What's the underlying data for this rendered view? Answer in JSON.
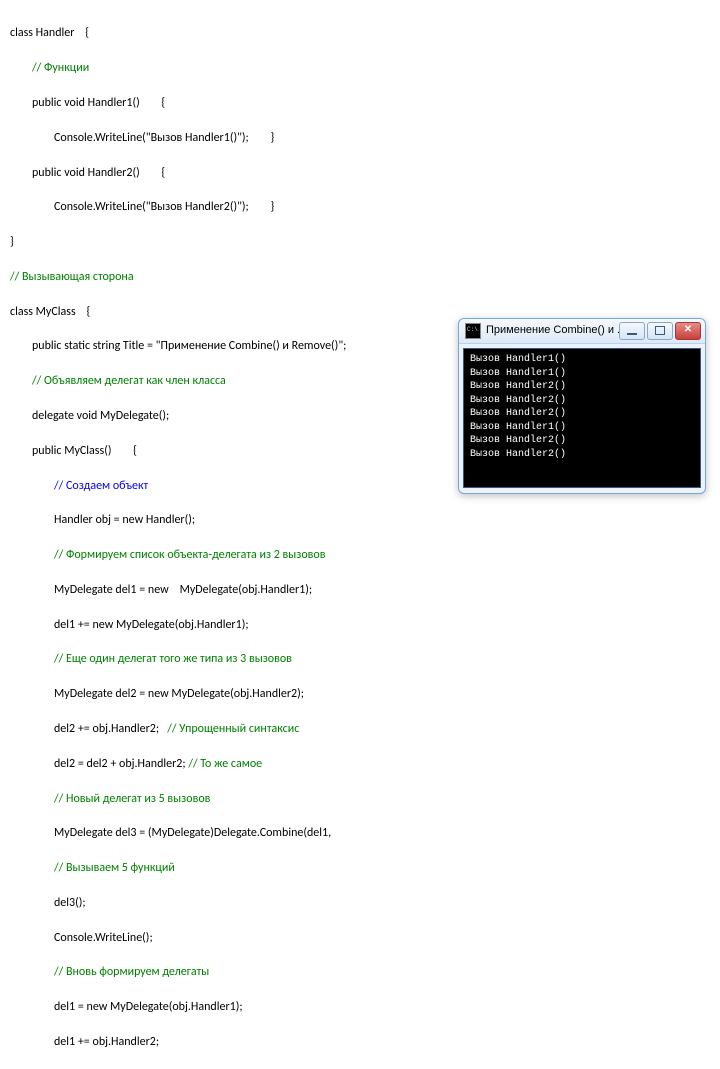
{
  "code": {
    "l1": "class Handler    {",
    "l2a": "// Функции",
    "l3": "public void Handler1()        {",
    "l4": "Console.WriteLine(\"Вызов Handler1()\");        }",
    "l5": "public void Handler2()        {",
    "l6": "Console.WriteLine(\"Вызов Handler2()\");        }",
    "l7": "}",
    "l8a": "// Вызывающая сторона",
    "l9": "class MyClass    {",
    "l10": "public static string Title = \"Применение Combine() и Remove()\";",
    "l11a": "// Объявляем делегат как член класса",
    "l12": "delegate void MyDelegate();",
    "l13": "public MyClass()        {",
    "l14a": "// Создаем объект",
    "l15": "Handler obj = new Handler();",
    "l16a": "// Формируем список объекта-делегата из 2 вызовов",
    "l17": "MyDelegate del1 = new    MyDelegate(obj.Handler1);",
    "l18": "del1 += new MyDelegate(obj.Handler1);",
    "l19a": "// Еще один делегат того же типа из 3 вызовов",
    "l20": "MyDelegate del2 = new MyDelegate(obj.Handler2);",
    "l21_pre": "del2 += obj.Handler2;   ",
    "l21a": "// Упрощенный синтаксис",
    "l22_pre": "del2 = del2 + obj.Handler2; ",
    "l22a": "// То же самое",
    "l23a": "// Новый делегат из 5 вызовов",
    "l24": "MyDelegate del3 = (MyDelegate)Delegate.Combine(del1,",
    "l25a": "// Вызываем 5 функций",
    "l26": "del3();",
    "l27": "Console.WriteLine();",
    "l28a": "// Вновь формируем делегаты",
    "l29": "del1 = new MyDelegate(obj.Handler1);",
    "l30": "del1 += obj.Handler2;"
  },
  "window": {
    "title": "Применение Combine() и ...",
    "lines": [
      "Вызов Handler1()",
      "Вызов Handler1()",
      "Вызов Handler2()",
      "Вызов Handler2()",
      "Вызов Handler2()",
      "",
      "Вызов Handler1()",
      "Вызов Handler2()",
      "Вызов Handler2()"
    ]
  }
}
